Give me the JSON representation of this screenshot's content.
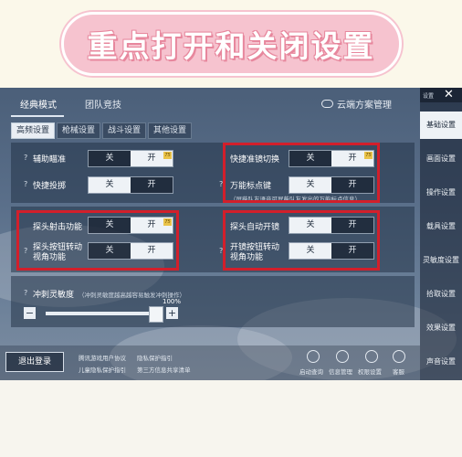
{
  "banner": {
    "title": "重点打开和关闭设置"
  },
  "main_tabs": [
    "经典模式",
    "团队竞技"
  ],
  "cloud_manager": "云端方案管理",
  "sub_tabs": [
    "高频设置",
    "枪械设置",
    "战斗设置",
    "其他设置"
  ],
  "toggle": {
    "off": "关",
    "on": "开"
  },
  "settings": {
    "aim_assist": "辅助瞄准",
    "quick_throw": "快捷投掷",
    "quick_scope_switch": "快捷准镜切换",
    "universal_marker": "万能标点键",
    "marker_hint": "（屏蔽队友语音可屏蔽队友发出的万能标点信息）",
    "peek_fire": "探头射击功能",
    "peek_auto_scope": "探头自动开镜",
    "peek_button_view": "探头按钮转动视角功能",
    "scope_button_view": "开镜按钮转动视角功能",
    "sprint_sensitivity": "冲刺灵敏度",
    "sprint_hint": "（冲刺灵敏度越高越容易触发冲刺操作）",
    "sprint_value": "100%",
    "minus": "−",
    "plus": "+"
  },
  "footer": {
    "logout": "退出登录",
    "links": [
      "腾讯游戏用户协议",
      "隐私保护指引",
      "儿童隐私保护指引",
      "第三方信息共享清单"
    ],
    "icons": [
      {
        "label": "启动查询",
        "icon": "search-icon"
      },
      {
        "label": "信息管理",
        "icon": "info-icon"
      },
      {
        "label": "权限设置",
        "icon": "lock-icon"
      },
      {
        "label": "客服",
        "icon": "headset-icon"
      }
    ]
  },
  "sidebar": {
    "title": "设置",
    "close": "✕",
    "items": [
      "基础设置",
      "画面设置",
      "操作设置",
      "载具设置",
      "灵敏度设置",
      "拾取设置",
      "效果设置",
      "声音设置"
    ]
  },
  "colors": {
    "highlight": "#d21f2b",
    "banner_pink": "#f6c3cf"
  }
}
